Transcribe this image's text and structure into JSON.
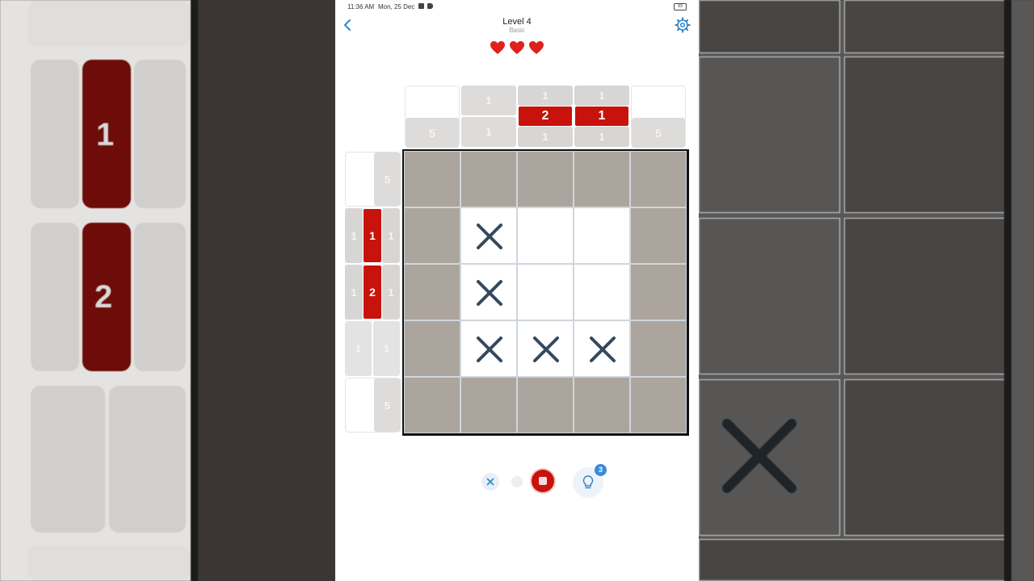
{
  "status_bar": {
    "time": "11:36 AM",
    "date": "Mon, 25 Dec",
    "battery": "93"
  },
  "header": {
    "title": "Level 4",
    "subtitle": "Basic"
  },
  "lives": {
    "count": 3,
    "color": "#e0201b"
  },
  "colors": {
    "active_clue": "#c7130b",
    "filled_cell": "#aca59d",
    "accent": "#3a8ad8",
    "x_mark": "#34495e"
  },
  "column_clues": [
    {
      "top": [],
      "bottom": [
        "5"
      ]
    },
    {
      "top": [
        "1"
      ],
      "bottom": [
        "1"
      ]
    },
    {
      "top": [
        "1"
      ],
      "active": "2",
      "bottom": [
        "1"
      ]
    },
    {
      "top": [
        "1"
      ],
      "active": "1",
      "bottom": [
        "1"
      ]
    },
    {
      "top": [],
      "bottom": [
        "5"
      ]
    }
  ],
  "row_clues": [
    {
      "left": [],
      "right": [
        "5"
      ]
    },
    {
      "left": [
        "1"
      ],
      "active": "1",
      "right": [
        "1"
      ]
    },
    {
      "left": [
        "1"
      ],
      "active": "2",
      "right": [
        "1"
      ]
    },
    {
      "left": [
        "1"
      ],
      "right": [
        "1"
      ]
    },
    {
      "left": [],
      "right": [
        "5"
      ]
    }
  ],
  "grid": {
    "size": 5,
    "cells": [
      [
        "filled",
        "filled",
        "filled",
        "filled",
        "filled"
      ],
      [
        "filled",
        "x",
        "empty",
        "empty",
        "filled"
      ],
      [
        "filled",
        "x",
        "empty",
        "empty",
        "filled"
      ],
      [
        "filled",
        "x",
        "x",
        "x",
        "filled"
      ],
      [
        "filled",
        "filled",
        "filled",
        "filled",
        "filled"
      ]
    ]
  },
  "controls": {
    "hint_count": "3",
    "mode_selected": "fill"
  },
  "icons": {
    "back": "chevron-left-icon",
    "settings": "gear-icon",
    "hint": "lightbulb-icon",
    "x_mode": "x-icon",
    "fill_mode": "square-icon"
  }
}
